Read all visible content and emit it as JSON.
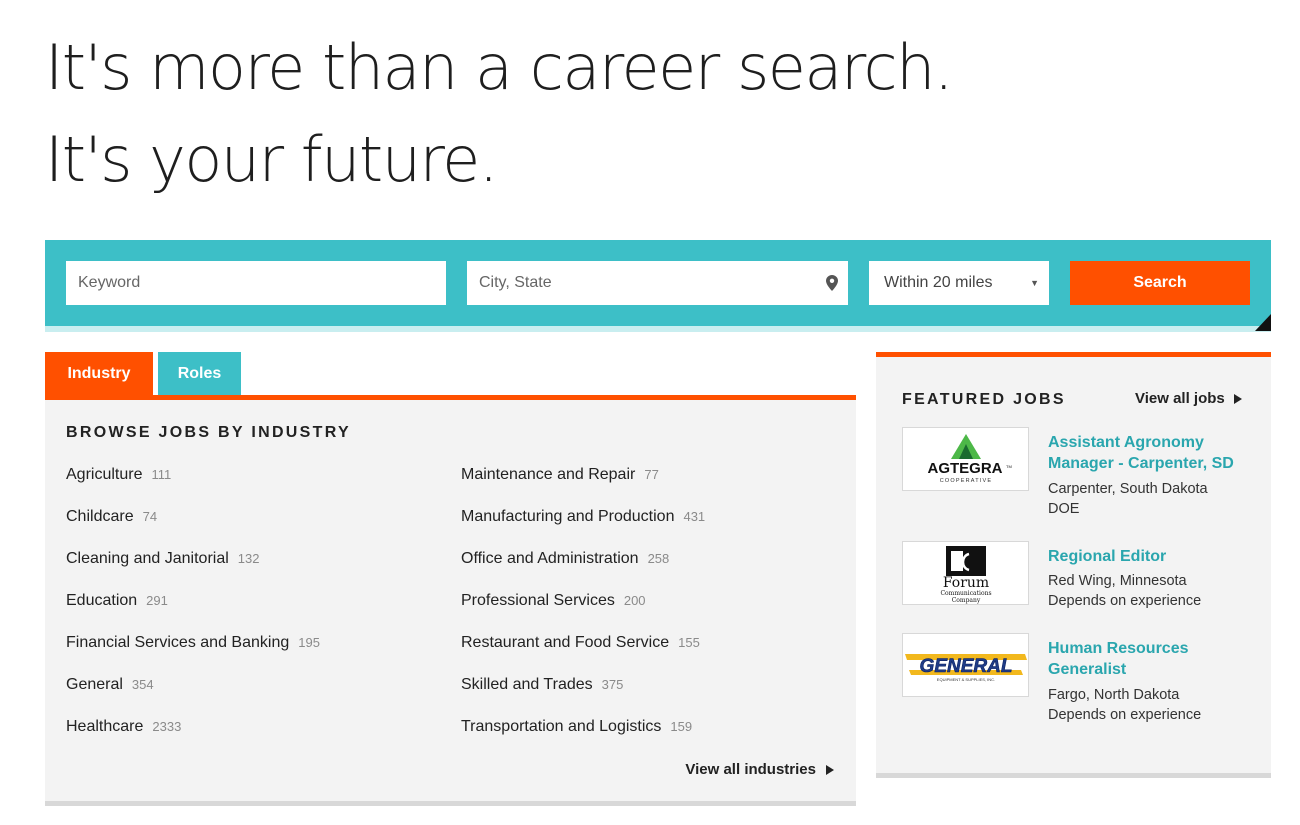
{
  "hero": {
    "line1": "It's more than a career search.",
    "line2": "It's your future."
  },
  "search": {
    "keyword_placeholder": "Keyword",
    "location_placeholder": "City, State",
    "location_icon": "map-pin-icon",
    "radius_selected": "Within 20 miles",
    "button_label": "Search"
  },
  "tabs": [
    {
      "label": "Industry",
      "active": true
    },
    {
      "label": "Roles",
      "active": false
    }
  ],
  "browse": {
    "title": "BROWSE JOBS BY INDUSTRY",
    "left_column": [
      {
        "name": "Agriculture",
        "count": "111"
      },
      {
        "name": "Childcare",
        "count": "74"
      },
      {
        "name": "Cleaning and Janitorial",
        "count": "132"
      },
      {
        "name": "Education",
        "count": "291"
      },
      {
        "name": "Financial Services and Banking",
        "count": "195"
      },
      {
        "name": "General",
        "count": "354"
      },
      {
        "name": "Healthcare",
        "count": "2333"
      }
    ],
    "right_column": [
      {
        "name": "Maintenance and Repair",
        "count": "77"
      },
      {
        "name": "Manufacturing and Production",
        "count": "431"
      },
      {
        "name": "Office and Administration",
        "count": "258"
      },
      {
        "name": "Professional Services",
        "count": "200"
      },
      {
        "name": "Restaurant and Food Service",
        "count": "155"
      },
      {
        "name": "Skilled and Trades",
        "count": "375"
      },
      {
        "name": "Transportation and Logistics",
        "count": "159"
      }
    ],
    "view_all_label": "View all industries"
  },
  "featured": {
    "title": "FEATURED JOBS",
    "view_all_label": "View all jobs",
    "jobs": [
      {
        "title": "Assistant Agronomy Manager - Carpenter, SD",
        "location": "Carpenter, South Dakota",
        "pay": "DOE",
        "logo": {
          "name": "AGTEGRA",
          "sub": "COOPERATIVE",
          "tm": "TM"
        }
      },
      {
        "title": "Regional Editor",
        "location": "Red Wing, Minnesota",
        "pay": "Depends on experience",
        "logo": {
          "name": "Forum",
          "sub1": "Communications",
          "sub2": "Company"
        }
      },
      {
        "title": "Human Resources Generalist",
        "location": "Fargo, North Dakota",
        "pay": "Depends on experience",
        "logo": {
          "name": "GENERAL",
          "sub": "EQUIPMENT & SUPPLIES, INC."
        }
      }
    ]
  },
  "colors": {
    "teal": "#3dbfc7",
    "orange": "#ff5000",
    "link_teal": "#2aa6ae",
    "panel_gray": "#f3f3f3"
  }
}
